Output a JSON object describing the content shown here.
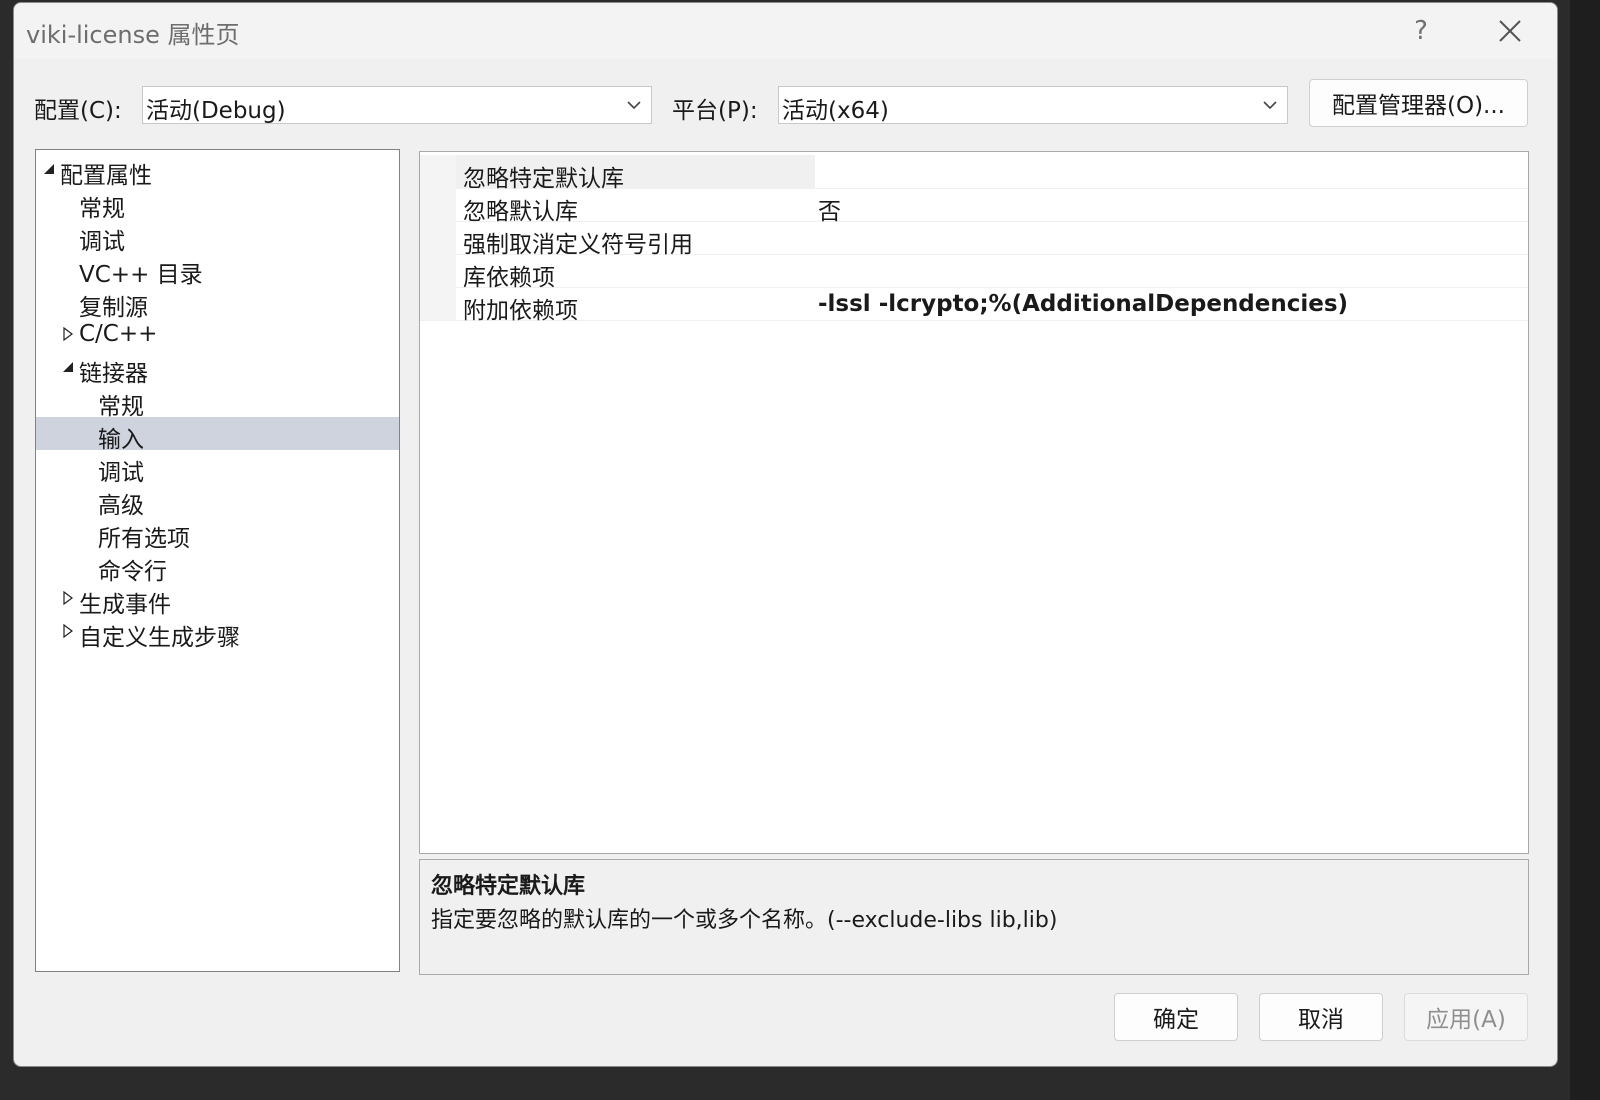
{
  "window": {
    "title": "viki-license 属性页",
    "help_label": "?"
  },
  "config": {
    "label": "配置(C):",
    "value": "活动(Debug)",
    "platform_label": "平台(P):",
    "platform_value": "活动(x64)",
    "manager_button": "配置管理器(O)..."
  },
  "tree": {
    "items": [
      {
        "label": "配置属性",
        "expander": "expanded"
      },
      {
        "label": "常规",
        "expander": "none"
      },
      {
        "label": "调试",
        "expander": "none"
      },
      {
        "label": "VC++ 目录",
        "expander": "none"
      },
      {
        "label": "复制源",
        "expander": "none"
      },
      {
        "label": "C/C++",
        "expander": "collapsed"
      },
      {
        "label": "链接器",
        "expander": "expanded"
      },
      {
        "label": "常规",
        "expander": "none"
      },
      {
        "label": "输入",
        "expander": "none",
        "selected": true
      },
      {
        "label": "调试",
        "expander": "none"
      },
      {
        "label": "高级",
        "expander": "none"
      },
      {
        "label": "所有选项",
        "expander": "none"
      },
      {
        "label": "命令行",
        "expander": "none"
      },
      {
        "label": "生成事件",
        "expander": "collapsed"
      },
      {
        "label": "自定义生成步骤",
        "expander": "collapsed"
      }
    ]
  },
  "properties": {
    "rows": [
      {
        "name": "忽略特定默认库",
        "value": ""
      },
      {
        "name": "忽略默认库",
        "value": "否"
      },
      {
        "name": "强制取消定义符号引用",
        "value": ""
      },
      {
        "name": "库依赖项",
        "value": ""
      },
      {
        "name": "附加依赖项",
        "value": "-lssl -lcrypto;%(AdditionalDependencies)"
      }
    ]
  },
  "description": {
    "title": "忽略特定默认库",
    "text": "指定要忽略的默认库的一个或多个名称。(--exclude-libs lib,lib)"
  },
  "buttons": {
    "ok": "确定",
    "cancel": "取消",
    "apply": "应用(A)"
  }
}
